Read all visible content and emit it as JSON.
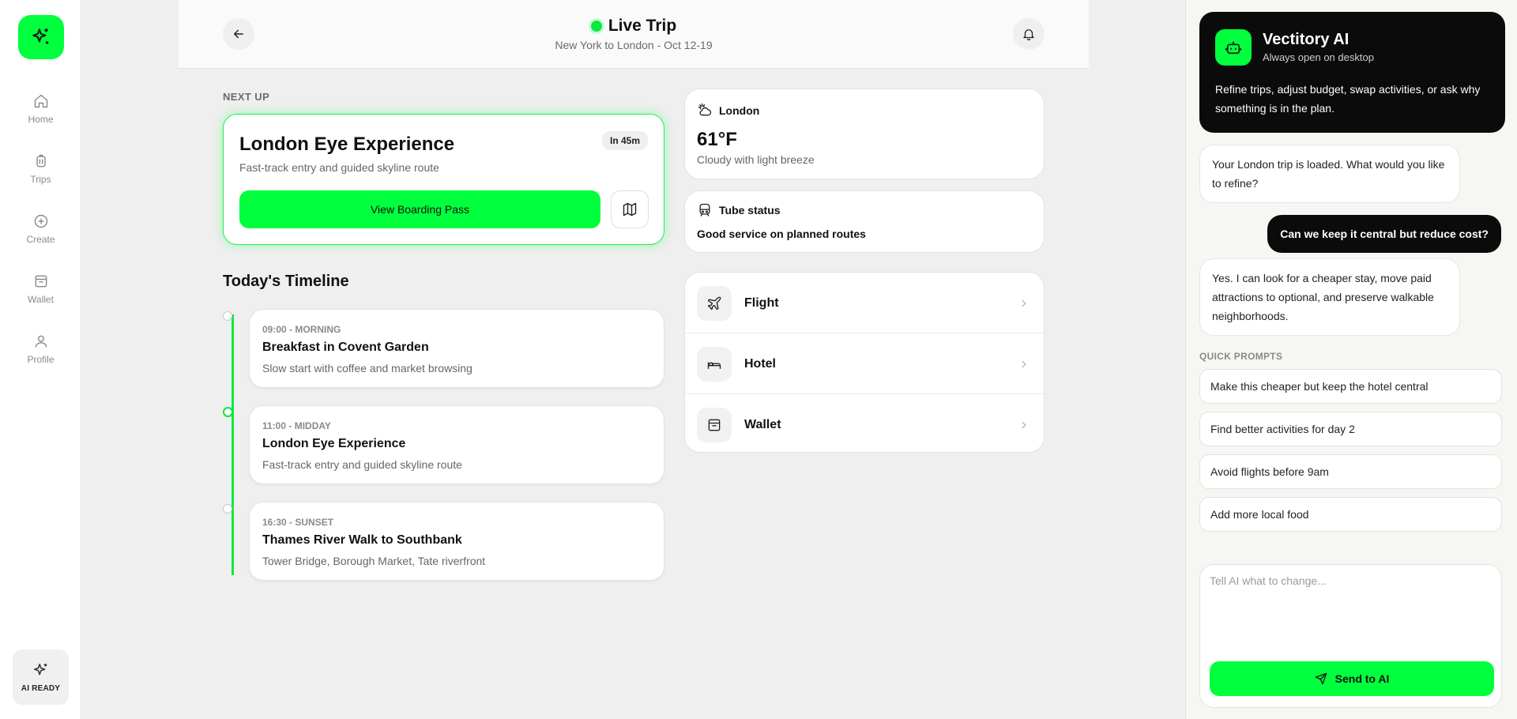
{
  "sidebar": {
    "logo_icon": "sparkles-icon",
    "items": [
      {
        "label": "Home",
        "icon": "home-icon"
      },
      {
        "label": "Trips",
        "icon": "luggage-icon"
      },
      {
        "label": "Create",
        "icon": "plus-circle-icon"
      },
      {
        "label": "Wallet",
        "icon": "wallet-icon"
      },
      {
        "label": "Profile",
        "icon": "user-icon"
      }
    ],
    "ai_ready": "AI READY"
  },
  "header": {
    "title": "Live Trip",
    "subtitle": "New York to London - Oct 12-19"
  },
  "next_up": {
    "label": "NEXT UP",
    "title": "London Eye Experience",
    "subtitle": "Fast-track entry and guided skyline route",
    "badge": "In 45m",
    "button": "View Boarding Pass"
  },
  "timeline": {
    "title": "Today's Timeline",
    "items": [
      {
        "time": "09:00 - MORNING",
        "name": "Breakfast in Covent Garden",
        "desc": "Slow start with coffee and market browsing"
      },
      {
        "time": "11:00 - MIDDAY",
        "name": "London Eye Experience",
        "desc": "Fast-track entry and guided skyline route"
      },
      {
        "time": "16:30 - SUNSET",
        "name": "Thames River Walk to Southbank",
        "desc": "Tower Bridge, Borough Market, Tate riverfront"
      }
    ]
  },
  "weather": {
    "city": "London",
    "temp": "61°F",
    "desc": "Cloudy with light breeze"
  },
  "tube": {
    "title": "Tube status",
    "status": "Good service on planned routes"
  },
  "links": [
    {
      "label": "Flight",
      "icon": "plane-icon"
    },
    {
      "label": "Hotel",
      "icon": "bed-icon"
    },
    {
      "label": "Wallet",
      "icon": "wallet-icon"
    }
  ],
  "ai": {
    "title": "Vectitory AI",
    "subtitle": "Always open on desktop",
    "description": "Refine trips, adjust budget, swap activities, or ask why something is in the plan.",
    "messages": [
      {
        "role": "ai",
        "text": "Your London trip is loaded. What would you like to refine?"
      },
      {
        "role": "user",
        "text": "Can we keep it central but reduce cost?"
      },
      {
        "role": "ai",
        "text": "Yes. I can look for a cheaper stay, move paid attractions to optional, and preserve walkable neighborhoods."
      }
    ],
    "quick_prompts_label": "QUICK PROMPTS",
    "quick_prompts": [
      "Make this cheaper but keep the hotel central",
      "Find better activities for day 2",
      "Avoid flights before 9am",
      "Add more local food"
    ],
    "input_placeholder": "Tell AI what to change...",
    "send_label": "Send to AI"
  },
  "colors": {
    "accent": "#00ff3c",
    "dark": "#0b0b0b"
  }
}
